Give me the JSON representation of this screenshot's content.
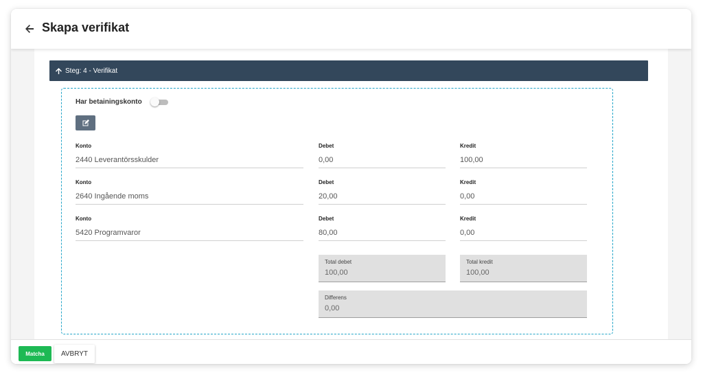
{
  "header": {
    "title": "Skapa verifikat",
    "back_icon": "arrow-left-icon"
  },
  "step": {
    "label": "Steg: 4 - Verifikat",
    "icon": "arrow-up-icon"
  },
  "form": {
    "payment_toggle_label": "Har betainingskonto",
    "payment_toggle_on": false,
    "edit_icon": "edit-icon",
    "rows": [
      {
        "konto_label": "Konto",
        "konto": "2440 Leverantörsskulder",
        "debet_label": "Debet",
        "debet": "0,00",
        "kredit_label": "Kredit",
        "kredit": "100,00"
      },
      {
        "konto_label": "Konto",
        "konto": "2640 Ingående moms",
        "debet_label": "Debet",
        "debet": "20,00",
        "kredit_label": "Kredit",
        "kredit": "0,00"
      },
      {
        "konto_label": "Konto",
        "konto": "5420 Programvaror",
        "debet_label": "Debet",
        "debet": "80,00",
        "kredit_label": "Kredit",
        "kredit": "0,00"
      }
    ],
    "totals": {
      "total_debet_label": "Total debet",
      "total_debet": "100,00",
      "total_kredit_label": "Total kredit",
      "total_kredit": "100,00",
      "differens_label": "Differens",
      "differens": "0,00"
    }
  },
  "footer": {
    "match_label": "Matcha",
    "cancel_label": "AVBRYT"
  },
  "colors": {
    "step_bar": "#33475b",
    "match_button": "#1db954",
    "dashed_border": "#20a4c8"
  }
}
